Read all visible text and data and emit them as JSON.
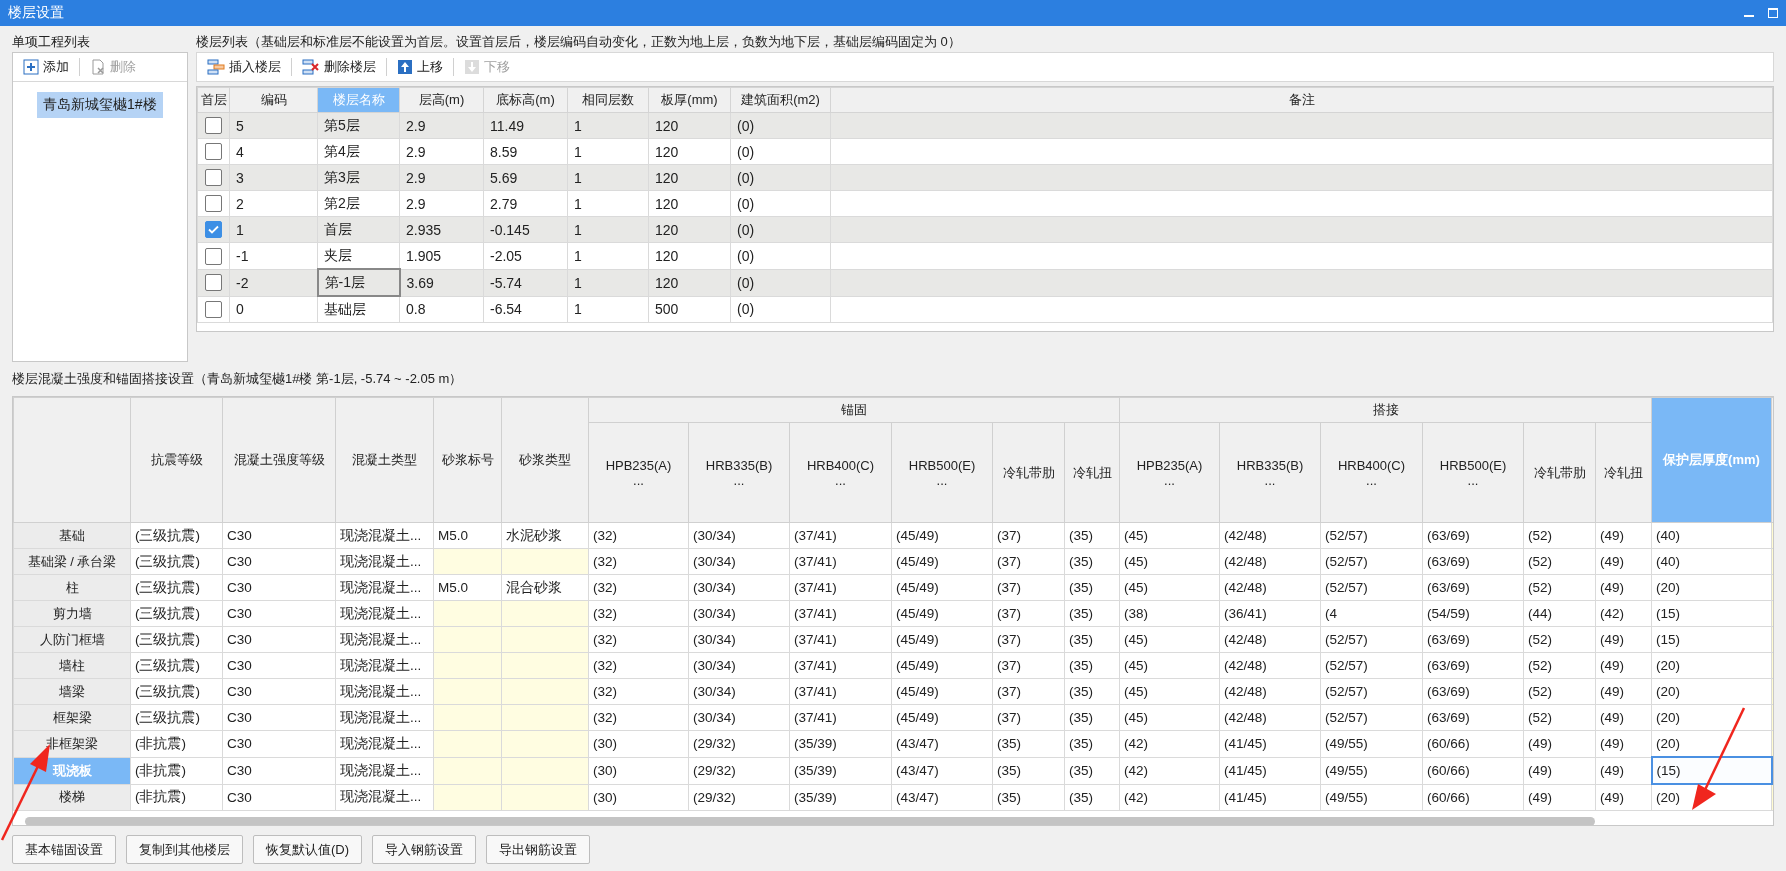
{
  "window": {
    "title": "楼层设置"
  },
  "project_list": {
    "title": "单项工程列表",
    "toolbar": [
      {
        "label": "添加",
        "kind": "add",
        "disabled": false
      },
      {
        "label": "删除",
        "kind": "delete",
        "disabled": true
      }
    ],
    "items": [
      {
        "label": "青岛新城玺樾1#楼",
        "selected": true
      }
    ]
  },
  "floor_list": {
    "title": "楼层列表（基础层和标准层不能设置为首层。设置首层后，楼层编码自动变化，正数为地上层，负数为地下层，基础层编码固定为 0）",
    "toolbar": [
      {
        "label": "插入楼层",
        "kind": "insert",
        "disabled": false
      },
      {
        "label": "删除楼层",
        "kind": "remove",
        "disabled": false
      },
      {
        "label": "上移",
        "kind": "up",
        "disabled": false
      },
      {
        "label": "下移",
        "kind": "down",
        "disabled": true
      }
    ],
    "checkbox_column": {
      "label": "首层",
      "selected": false
    },
    "columns": [
      {
        "label": "编码",
        "selected": false
      },
      {
        "label": "楼层名称",
        "selected": true
      },
      {
        "label": "层高(m)",
        "selected": false
      },
      {
        "label": "底标高(m)",
        "selected": false
      },
      {
        "label": "相同层数",
        "selected": false
      },
      {
        "label": "板厚(mm)",
        "selected": false
      },
      {
        "label": "建筑面积(m2)",
        "selected": false
      },
      {
        "label": "备注",
        "selected": false
      }
    ],
    "rows": [
      {
        "first_floor": false,
        "focused": false,
        "cells": [
          "5",
          "第5层",
          "2.9",
          "11.49",
          "1",
          "120",
          "(0)"
        ]
      },
      {
        "first_floor": false,
        "focused": false,
        "cells": [
          "4",
          "第4层",
          "2.9",
          "8.59",
          "1",
          "120",
          "(0)"
        ]
      },
      {
        "first_floor": false,
        "focused": false,
        "cells": [
          "3",
          "第3层",
          "2.9",
          "5.69",
          "1",
          "120",
          "(0)"
        ]
      },
      {
        "first_floor": false,
        "focused": false,
        "cells": [
          "2",
          "第2层",
          "2.9",
          "2.79",
          "1",
          "120",
          "(0)"
        ]
      },
      {
        "first_floor": true,
        "focused": false,
        "cells": [
          "1",
          "首层",
          "2.935",
          "-0.145",
          "1",
          "120",
          "(0)"
        ]
      },
      {
        "first_floor": false,
        "focused": false,
        "cells": [
          "-1",
          "夹层",
          "1.905",
          "-2.05",
          "1",
          "120",
          "(0)"
        ]
      },
      {
        "first_floor": false,
        "focused": true,
        "cells": [
          "-2",
          "第-1层",
          "3.69",
          "-5.74",
          "1",
          "120",
          "(0)"
        ]
      },
      {
        "first_floor": false,
        "focused": false,
        "cells": [
          "0",
          "基础层",
          "0.8",
          "-6.54",
          "1",
          "500",
          "(0)"
        ]
      }
    ]
  },
  "settings": {
    "title": "楼层混凝土强度和锚固搭接设置（青岛新城玺樾1#楼  第-1层, -5.74 ~ -2.05 m）",
    "groups": [
      "锚固",
      "搭接"
    ],
    "columns": [
      {
        "label": "抗震等级",
        "selected": false
      },
      {
        "label": "混凝土强度等级",
        "selected": false
      },
      {
        "label": "混凝土类型",
        "selected": false
      },
      {
        "label": "砂浆标号",
        "selected": false
      },
      {
        "label": "砂浆类型",
        "selected": false
      },
      {
        "label": "HPB235(A)",
        "sub": "...",
        "selected": false
      },
      {
        "label": "HRB335(B)",
        "sub": "...",
        "selected": false
      },
      {
        "label": "HRB400(C)",
        "sub": "...",
        "selected": false
      },
      {
        "label": "HRB500(E)",
        "sub": "...",
        "selected": false
      },
      {
        "label": "冷轧带肋",
        "selected": false
      },
      {
        "label": "冷轧扭",
        "selected": false
      },
      {
        "label": "HPB235(A)",
        "sub": "...",
        "selected": false
      },
      {
        "label": "HRB335(B)",
        "sub": "...",
        "selected": false
      },
      {
        "label": "HRB400(C)",
        "sub": "...",
        "selected": false
      },
      {
        "label": "HRB500(E)",
        "sub": "...",
        "selected": false
      },
      {
        "label": "冷轧带肋",
        "selected": false
      },
      {
        "label": "冷轧扭",
        "selected": false
      },
      {
        "label": "保护层厚度(mm)",
        "selected": true
      }
    ],
    "rows": [
      {
        "name": "基础",
        "selected": false,
        "cover_focused": false,
        "cells": [
          "(三级抗震)",
          "C30",
          "现浇混凝土...",
          "M5.0",
          "水泥砂浆",
          "(32)",
          "(30/34)",
          "(37/41)",
          "(45/49)",
          "(37)",
          "(35)",
          "(45)",
          "(42/48)",
          "(52/57)",
          "(63/69)",
          "(52)",
          "(49)",
          "(40)"
        ]
      },
      {
        "name": "基础梁 / 承台梁",
        "selected": false,
        "cover_focused": false,
        "cells": [
          "(三级抗震)",
          "C30",
          "现浇混凝土...",
          null,
          null,
          "(32)",
          "(30/34)",
          "(37/41)",
          "(45/49)",
          "(37)",
          "(35)",
          "(45)",
          "(42/48)",
          "(52/57)",
          "(63/69)",
          "(52)",
          "(49)",
          "(40)"
        ]
      },
      {
        "name": "柱",
        "selected": false,
        "cover_focused": false,
        "cells": [
          "(三级抗震)",
          "C30",
          "现浇混凝土...",
          "M5.0",
          "混合砂浆",
          "(32)",
          "(30/34)",
          "(37/41)",
          "(45/49)",
          "(37)",
          "(35)",
          "(45)",
          "(42/48)",
          "(52/57)",
          "(63/69)",
          "(52)",
          "(49)",
          "(20)"
        ]
      },
      {
        "name": "剪力墙",
        "selected": false,
        "cover_focused": false,
        "cells": [
          "(三级抗震)",
          "C30",
          "现浇混凝土...",
          null,
          null,
          "(32)",
          "(30/34)",
          "(37/41)",
          "(45/49)",
          "(37)",
          "(35)",
          "(38)",
          "(36/41)",
          "(4",
          "(54/59)",
          "(44)",
          "(42)",
          "(15)"
        ]
      },
      {
        "name": "人防门框墙",
        "selected": false,
        "cover_focused": false,
        "cells": [
          "(三级抗震)",
          "C30",
          "现浇混凝土...",
          null,
          null,
          "(32)",
          "(30/34)",
          "(37/41)",
          "(45/49)",
          "(37)",
          "(35)",
          "(45)",
          "(42/48)",
          "(52/57)",
          "(63/69)",
          "(52)",
          "(49)",
          "(15)"
        ]
      },
      {
        "name": "墙柱",
        "selected": false,
        "cover_focused": false,
        "cells": [
          "(三级抗震)",
          "C30",
          "现浇混凝土...",
          null,
          null,
          "(32)",
          "(30/34)",
          "(37/41)",
          "(45/49)",
          "(37)",
          "(35)",
          "(45)",
          "(42/48)",
          "(52/57)",
          "(63/69)",
          "(52)",
          "(49)",
          "(20)"
        ]
      },
      {
        "name": "墙梁",
        "selected": false,
        "cover_focused": false,
        "cells": [
          "(三级抗震)",
          "C30",
          "现浇混凝土...",
          null,
          null,
          "(32)",
          "(30/34)",
          "(37/41)",
          "(45/49)",
          "(37)",
          "(35)",
          "(45)",
          "(42/48)",
          "(52/57)",
          "(63/69)",
          "(52)",
          "(49)",
          "(20)"
        ]
      },
      {
        "name": "框架梁",
        "selected": false,
        "cover_focused": false,
        "cells": [
          "(三级抗震)",
          "C30",
          "现浇混凝土...",
          null,
          null,
          "(32)",
          "(30/34)",
          "(37/41)",
          "(45/49)",
          "(37)",
          "(35)",
          "(45)",
          "(42/48)",
          "(52/57)",
          "(63/69)",
          "(52)",
          "(49)",
          "(20)"
        ]
      },
      {
        "name": "非框架梁",
        "selected": false,
        "cover_focused": false,
        "cells": [
          "(非抗震)",
          "C30",
          "现浇混凝土...",
          null,
          null,
          "(30)",
          "(29/32)",
          "(35/39)",
          "(43/47)",
          "(35)",
          "(35)",
          "(42)",
          "(41/45)",
          "(49/55)",
          "(60/66)",
          "(49)",
          "(49)",
          "(20)"
        ]
      },
      {
        "name": "现浇板",
        "selected": true,
        "cover_focused": true,
        "cells": [
          "(非抗震)",
          "C30",
          "现浇混凝土...",
          null,
          null,
          "(30)",
          "(29/32)",
          "(35/39)",
          "(43/47)",
          "(35)",
          "(35)",
          "(42)",
          "(41/45)",
          "(49/55)",
          "(60/66)",
          "(49)",
          "(49)",
          "(15)"
        ]
      },
      {
        "name": "楼梯",
        "selected": false,
        "cover_focused": false,
        "cells": [
          "(非抗震)",
          "C30",
          "现浇混凝土...",
          null,
          null,
          "(30)",
          "(29/32)",
          "(35/39)",
          "(43/47)",
          "(35)",
          "(35)",
          "(42)",
          "(41/45)",
          "(49/55)",
          "(60/66)",
          "(49)",
          "(49)",
          "(20)"
        ]
      }
    ]
  },
  "buttons": [
    "基本锚固设置",
    "复制到其他楼层",
    "恢复默认值(D)",
    "导入钢筋设置",
    "导出钢筋设置"
  ]
}
